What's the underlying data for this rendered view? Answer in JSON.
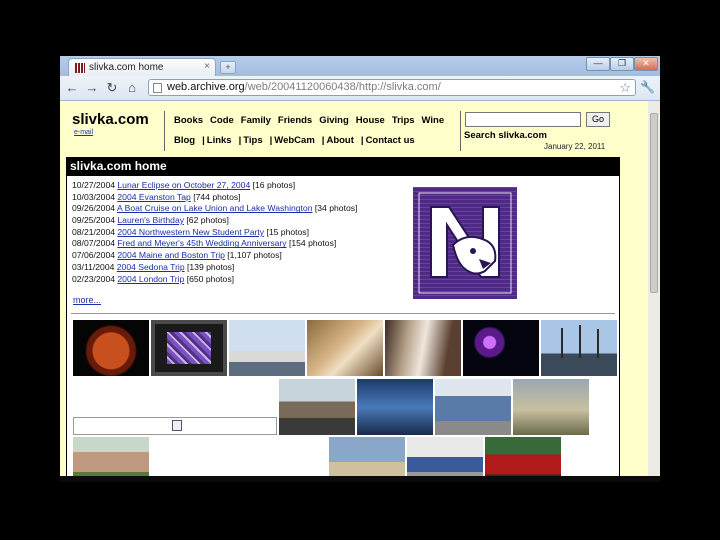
{
  "browser": {
    "tab_title": "slivka.com home",
    "tab_close": "×",
    "new_tab": "+",
    "url_host": "web.archive.org",
    "url_path": "/web/20041120060438/http://slivka.com/",
    "controls": {
      "minimize": "—",
      "maximize": "❐",
      "close": "✕"
    },
    "icons": {
      "back": "←",
      "forward": "→",
      "reload": "↻",
      "home": "⌂",
      "star": "☆",
      "wrench": "🔧"
    }
  },
  "site": {
    "brand": "slivka.com",
    "email_link": "e-mail",
    "nav_top": [
      "Books",
      "Code",
      "Family",
      "Friends",
      "Giving",
      "House",
      "Trips",
      "Wine"
    ],
    "nav_bottom": [
      "Blog",
      "Links",
      "Tips",
      "WebCam",
      "About",
      "Contact us"
    ],
    "nav_sep": "|",
    "search_button": "Go",
    "search_label": "Search slivka.com",
    "date": "January 22, 2011",
    "section_title": "slivka.com home",
    "more_link": "more...",
    "rows": [
      {
        "date": "10/27/2004",
        "link": "Lunar Eclipse on October 27, 2004",
        "count": "[16 photos]"
      },
      {
        "date": "10/03/2004",
        "link": "2004 Evanston Tap",
        "count": "[744 photos]"
      },
      {
        "date": "09/26/2004",
        "link": "A Boat Cruise on Lake Union and Lake Washington",
        "count": "[34 photos]"
      },
      {
        "date": "09/25/2004",
        "link": "Lauren's Birthday",
        "count": "[62 photos]"
      },
      {
        "date": "08/21/2004",
        "link": "2004 Northwestern New Student Party",
        "count": "[15 photos]"
      },
      {
        "date": "08/07/2004",
        "link": "Fred and Meyer's 45th Wedding Anniversary",
        "count": "[154 photos]"
      },
      {
        "date": "07/06/2004",
        "link": "2004 Maine and Boston Trip",
        "count": "[1,107 photos]"
      },
      {
        "date": "03/11/2004",
        "link": "2004 Sedona Trip",
        "count": "[139 photos]"
      },
      {
        "date": "02/23/2004",
        "link": "2004 London Trip",
        "count": "[650 photos]"
      }
    ]
  },
  "colors": {
    "page_bg": "#ffffcc",
    "link": "#1a2faa",
    "nu_purple": "#4e2a84"
  }
}
